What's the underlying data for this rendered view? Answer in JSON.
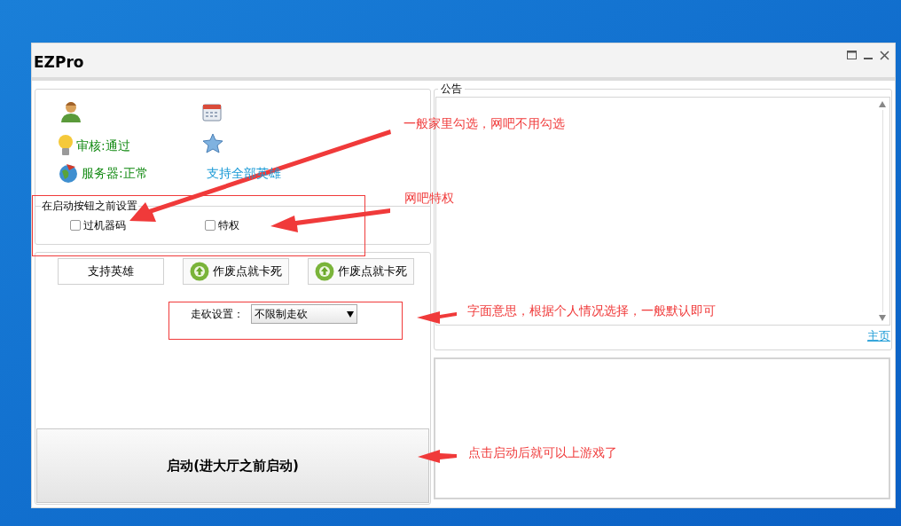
{
  "window": {
    "title": "EZPro"
  },
  "info": {
    "rows": [
      {
        "text": "审核:通过"
      },
      {
        "text": "服务器:正常"
      }
    ],
    "hero_link": "支持全部英雄"
  },
  "pre_launch": {
    "title": "在启动按钮之前设置",
    "options": [
      {
        "label": "过机器码",
        "checked": false
      },
      {
        "label": "特权",
        "checked": false
      }
    ]
  },
  "buttons": [
    {
      "label": "支持英雄",
      "kind": "plain"
    },
    {
      "label": "作废点就卡死",
      "kind": "icon"
    },
    {
      "label": "作废点就卡死",
      "kind": "icon"
    }
  ],
  "walk": {
    "label": "走砍设置：",
    "value": "不限制走砍"
  },
  "start_button": "启动(进大厅之前启动)",
  "notice": {
    "title": "公告",
    "link": "主页"
  },
  "annotations": [
    {
      "text": "一般家里勾选，网吧不用勾选"
    },
    {
      "text": "网吧特权"
    },
    {
      "text": "字面意思，根据个人情况选择，一般默认即可"
    },
    {
      "text": "点击启动后就可以上游戏了"
    }
  ]
}
